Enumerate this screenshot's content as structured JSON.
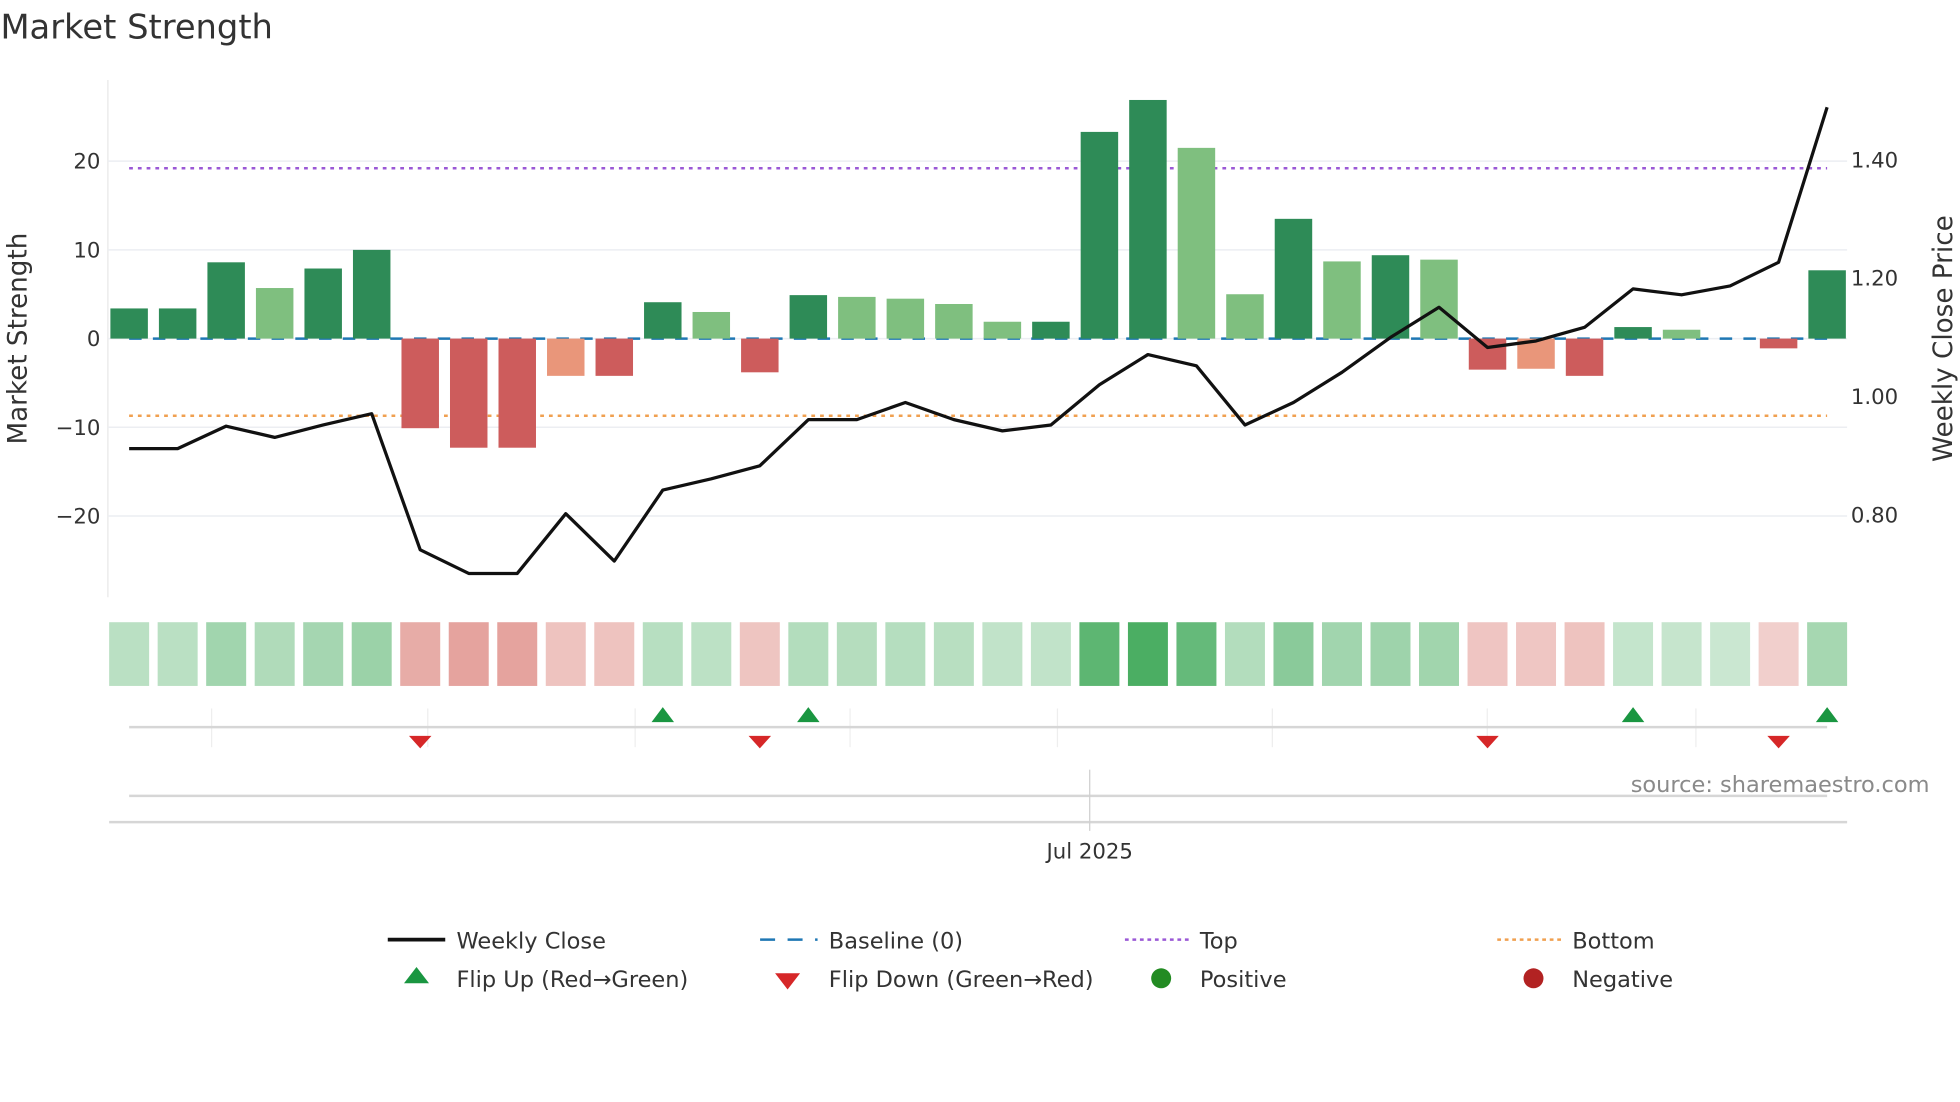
{
  "chart_data": {
    "type": "bar",
    "title": "Market Strength",
    "ylabel": "Market Strength",
    "y2label": "Weekly Close Price",
    "xlabel": "",
    "ylim": [
      -28,
      29
    ],
    "y2lim": [
      0.667,
      1.537
    ],
    "yticks": [
      "20",
      "10",
      "0",
      "−10",
      "−20"
    ],
    "ytick_values": [
      20,
      10,
      0,
      -10,
      -20
    ],
    "y2ticks": [
      "1.40",
      "1.20",
      "1.00",
      "0.80"
    ],
    "y2tick_values": [
      1.4,
      1.2,
      1.0,
      0.8
    ],
    "xtick_label": "Jul 2025",
    "xtick_index": 19.8,
    "source": "source: sharemaestro.com",
    "top_level": 19.2,
    "bottom_level": -8.7,
    "baseline": 0,
    "strength": [
      3.4,
      3.4,
      8.6,
      5.7,
      7.9,
      10.0,
      -10.1,
      -12.3,
      -12.3,
      -4.2,
      -4.2,
      4.1,
      3.0,
      -3.8,
      4.9,
      4.7,
      4.5,
      3.9,
      1.9,
      1.9,
      23.3,
      26.9,
      21.5,
      5.0,
      13.5,
      8.7,
      9.4,
      8.9,
      -3.5,
      -3.4,
      -4.2,
      1.3,
      1.0,
      0.0,
      -1.1,
      7.7
    ],
    "bar_shade": [
      "strong",
      "strong",
      "strong",
      "weak",
      "strong",
      "strong",
      "strong",
      "strong",
      "strong",
      "weak",
      "strong",
      "strong",
      "weak",
      "strong",
      "strong",
      "weak",
      "weak",
      "weak",
      "weak",
      "strong",
      "strong",
      "strong",
      "weak",
      "weak",
      "strong",
      "weak",
      "strong",
      "weak",
      "strong",
      "weak",
      "strong",
      "strong",
      "weak",
      "weak",
      "strong",
      "strong"
    ],
    "weekly_close": [
      0.912,
      0.912,
      0.95,
      0.931,
      0.952,
      0.971,
      0.741,
      0.701,
      0.701,
      0.802,
      0.722,
      0.842,
      0.861,
      0.883,
      0.961,
      0.961,
      0.99,
      0.961,
      0.942,
      0.952,
      1.02,
      1.071,
      1.052,
      0.952,
      0.99,
      1.041,
      1.1,
      1.151,
      1.083,
      1.094,
      1.117,
      1.182,
      1.172,
      1.187,
      1.227,
      1.489
    ],
    "flip_up_indices": [
      11,
      14,
      31,
      35
    ],
    "flip_down_indices": [
      6,
      13,
      28,
      34
    ],
    "colors": {
      "strong_green": "#2e8b57",
      "weak_green": "#7fbf7f",
      "strong_red": "#cd5c5c",
      "weak_red": "#e9967a",
      "baseline": "#1f77b4",
      "top": "#9b59d6",
      "bottom": "#f0a050",
      "close": "#111111",
      "flip_up": "#1a9641",
      "flip_down": "#d62728",
      "positive": "#228b22",
      "negative": "#b22222"
    },
    "legend": [
      {
        "label": "Weekly Close",
        "kind": "line"
      },
      {
        "label": "Baseline (0)",
        "kind": "dash"
      },
      {
        "label": "Top",
        "kind": "dotTop"
      },
      {
        "label": "Bottom",
        "kind": "dotBottom"
      },
      {
        "label": "Flip Up (Red→Green)",
        "kind": "up"
      },
      {
        "label": "Flip Down (Green→Red)",
        "kind": "down"
      },
      {
        "label": "Positive",
        "kind": "pos"
      },
      {
        "label": "Negative",
        "kind": "neg"
      }
    ],
    "legend_placement": "bottom"
  }
}
